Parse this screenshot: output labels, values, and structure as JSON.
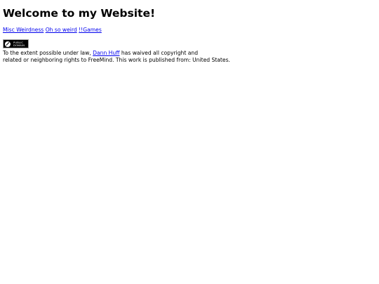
{
  "page": {
    "heading": "Welcome to my Website!"
  },
  "nav": {
    "links": [
      {
        "label": "Misc Weirdness"
      },
      {
        "label": "Oh so weird"
      },
      {
        "label": "!!Games"
      }
    ]
  },
  "badge": {
    "icon": "public-domain-icon",
    "line1": "PUBLIC",
    "line2": "DOMAIN"
  },
  "legal": {
    "prefix": "To the extent possible under law, ",
    "author": "Dann Huff",
    "suffix1": " has waived all copyright and",
    "line2": "related or neighboring rights to FreeMind. This work is published from: United States."
  },
  "colors": {
    "link": "#0000ee",
    "text": "#000000",
    "background": "#ffffff"
  }
}
